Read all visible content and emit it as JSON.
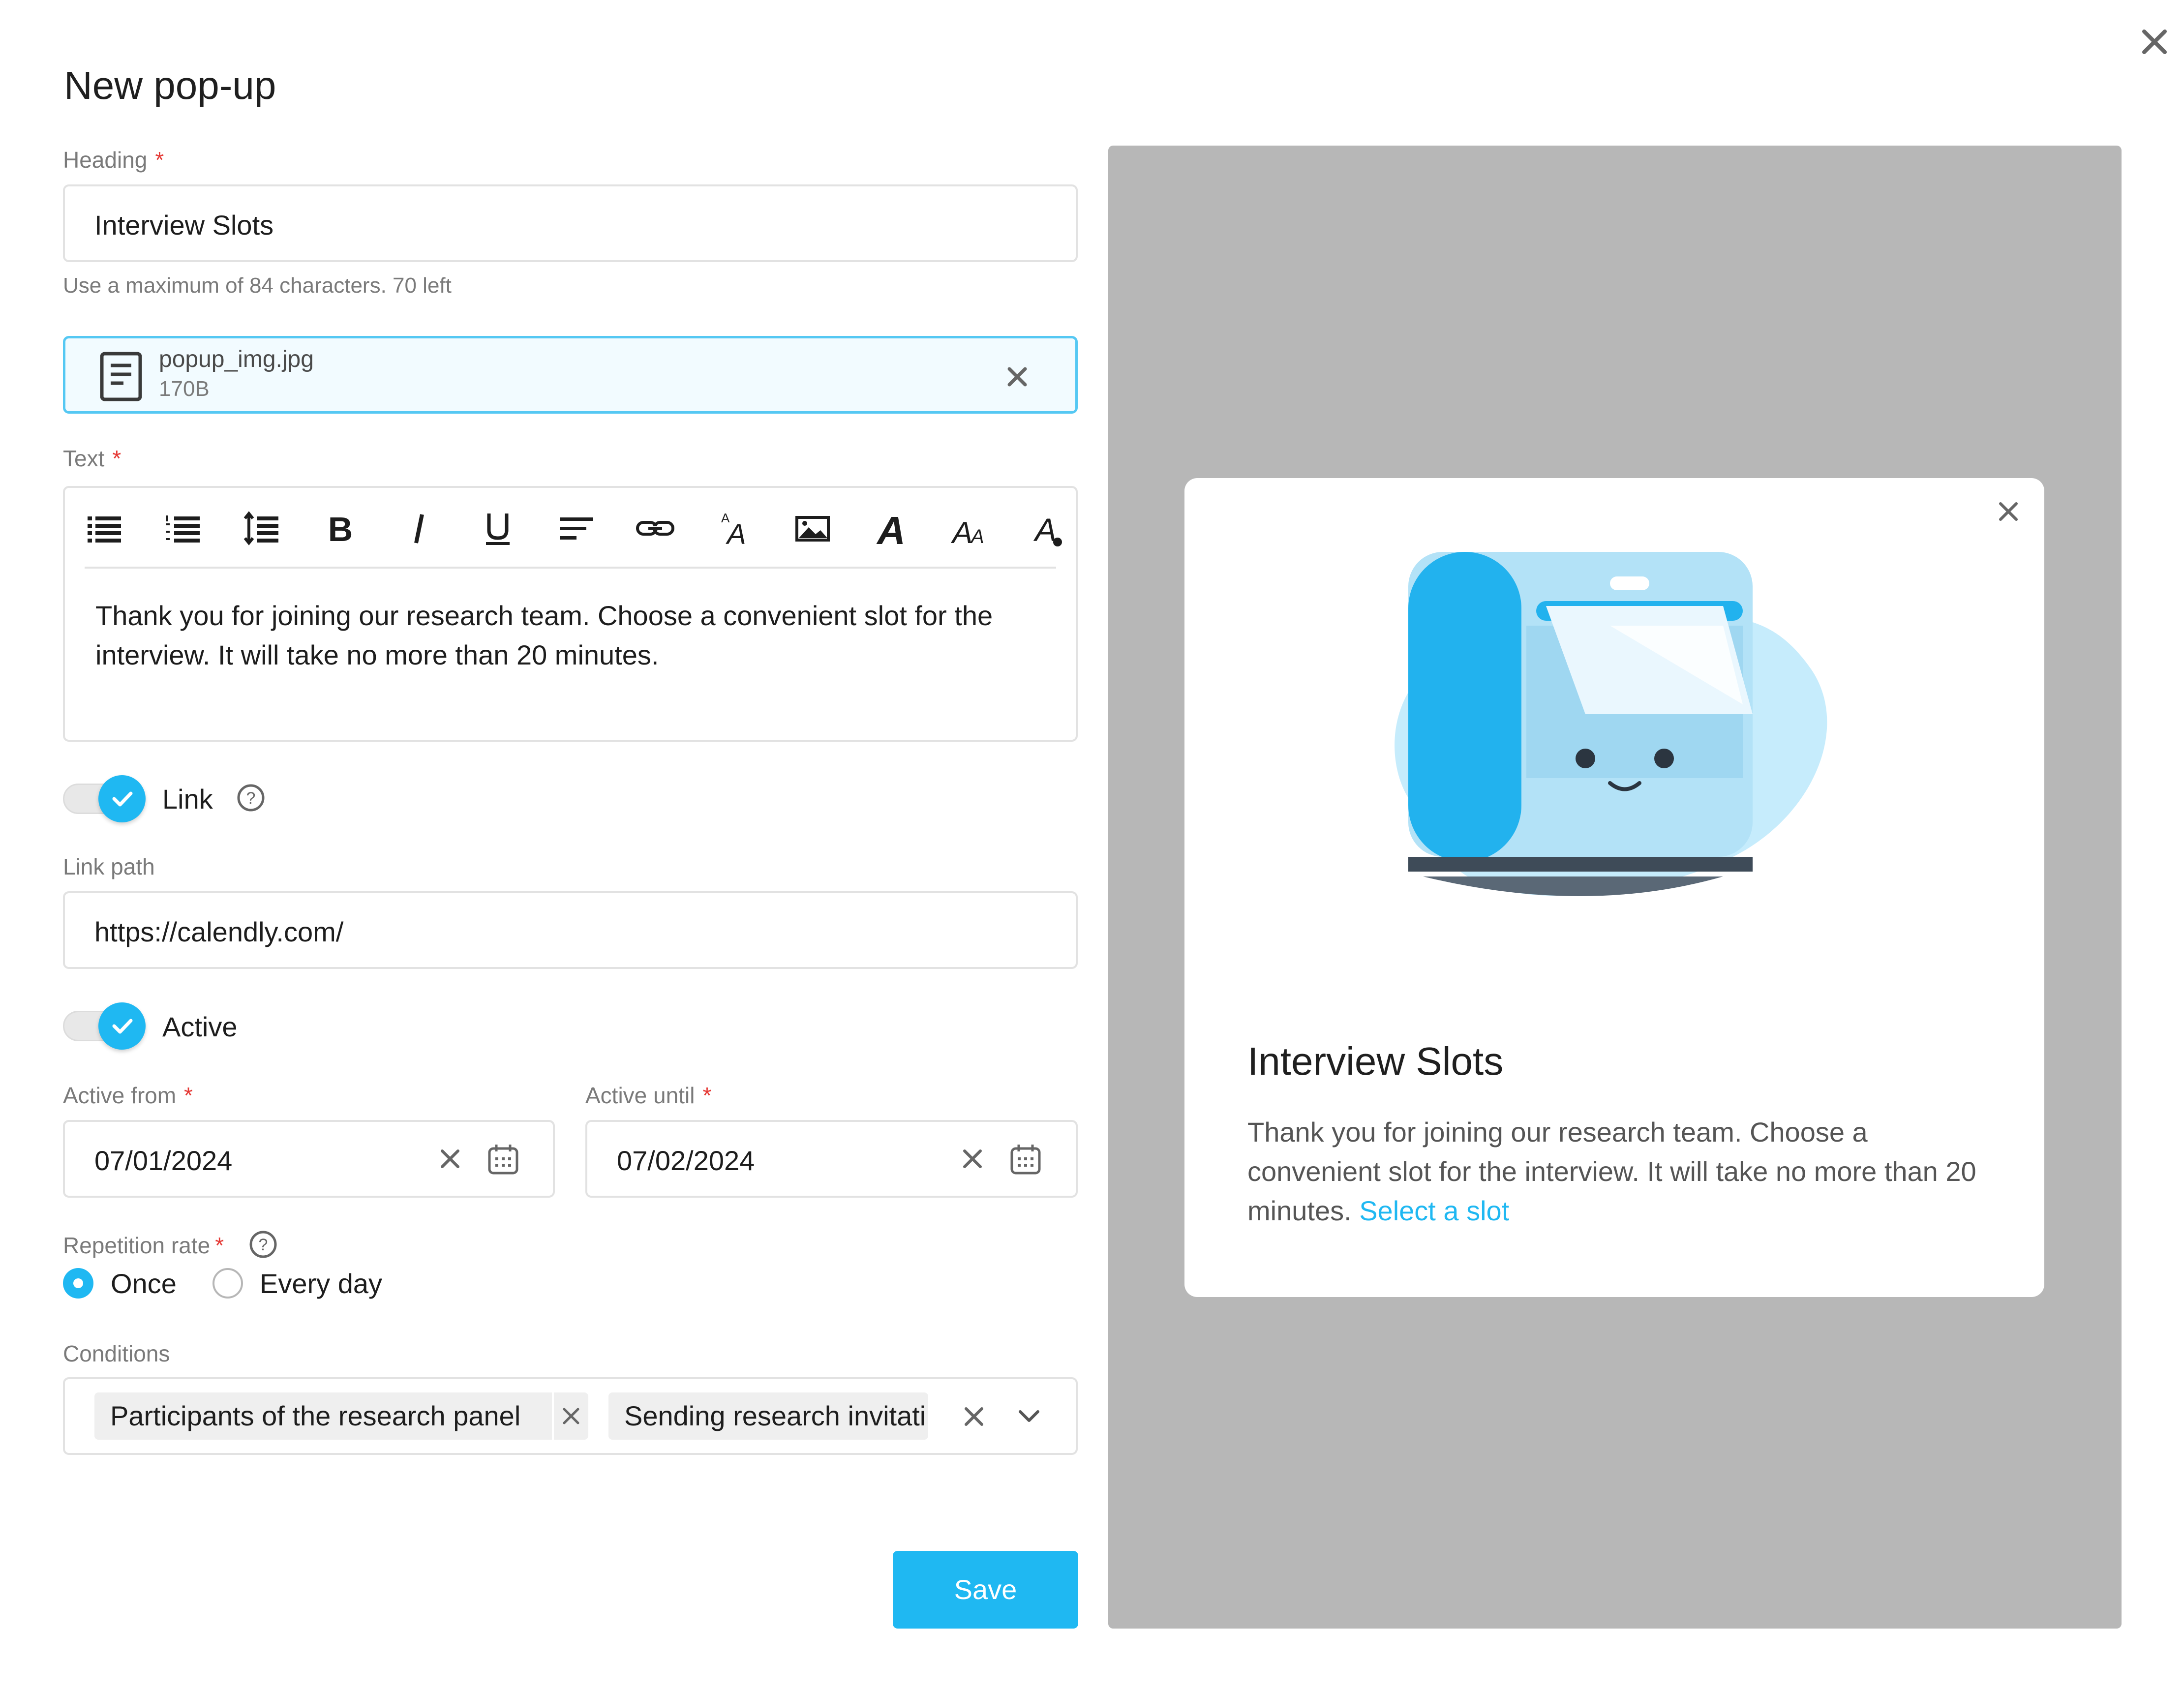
{
  "page": {
    "title": "New pop-up"
  },
  "heading_field": {
    "label": "Heading",
    "required_mark": "*",
    "value": "Interview Slots",
    "hint": "Use a maximum of 84 characters. 70 left"
  },
  "attachment": {
    "file_name": "popup_img.jpg",
    "file_size": "170B"
  },
  "text_field": {
    "label": "Text",
    "required_mark": "*",
    "toolbar": [
      "bulleted-list",
      "numbered-list",
      "line-spacing",
      "bold",
      "italic",
      "underline",
      "align",
      "link",
      "font-size",
      "image",
      "font-family",
      "text-case",
      "text-color"
    ],
    "value": "Thank you for joining our research team. Choose a convenient slot for the interview. It will take no more than 20 minutes."
  },
  "link_toggle": {
    "label": "Link",
    "checked": true
  },
  "link_path": {
    "label": "Link path",
    "value": "https://calendly.com/"
  },
  "active_toggle": {
    "label": "Active",
    "checked": true
  },
  "active_from": {
    "label": "Active from",
    "required_mark": "*",
    "value": "07/01/2024"
  },
  "active_until": {
    "label": "Active until",
    "required_mark": "*",
    "value": "07/02/2024"
  },
  "repetition": {
    "label": "Repetition rate",
    "required_mark": "*",
    "options": [
      "Once",
      "Every day"
    ],
    "selected": "Once"
  },
  "conditions": {
    "label": "Conditions",
    "chips": [
      "Participants of the research panel",
      "Sending research invitati"
    ]
  },
  "save_label": "Save",
  "preview": {
    "title": "Interview Slots",
    "text": "Thank you for joining our research team. Choose a convenient slot for the interview. It will take no more than 20 minutes.",
    "link_text": "Select a slot"
  },
  "colors": {
    "accent": "#1fb8f2",
    "preview_bg": "#b7b7b7",
    "required": "#e53935"
  }
}
